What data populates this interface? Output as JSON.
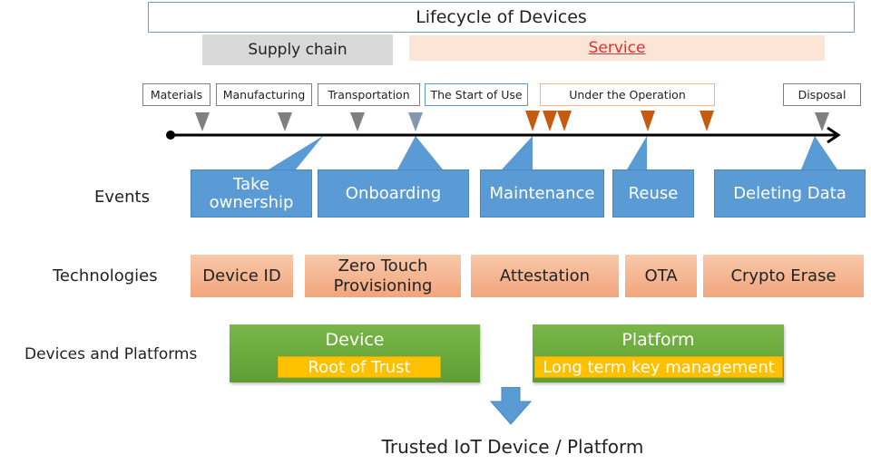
{
  "header": {
    "title": "Lifecycle of Devices",
    "supply_chain": "Supply chain",
    "service": "Service"
  },
  "stages": [
    {
      "label": "Materials",
      "style": "gray"
    },
    {
      "label": "Manufacturing",
      "style": "gray"
    },
    {
      "label": "Transportation",
      "style": "gray"
    },
    {
      "label": "The Start of Use",
      "style": "blue"
    },
    {
      "label": "Under the Operation",
      "style": "orange"
    },
    {
      "label": "Disposal",
      "style": "gray"
    }
  ],
  "markers": {
    "colors": {
      "gray": "#7f7f7f",
      "blue_gray": "#8497b0",
      "orange": "#c55a11"
    },
    "count_gray": 4,
    "count_orange": 5,
    "count_disposal": 1
  },
  "row_labels": {
    "events": "Events",
    "technologies": "Technologies",
    "devices_platforms": "Devices and Platforms"
  },
  "events": [
    {
      "label": "Take ownership"
    },
    {
      "label": "Onboarding"
    },
    {
      "label": "Maintenance"
    },
    {
      "label": "Reuse"
    },
    {
      "label": "Deleting Data"
    }
  ],
  "technologies": [
    {
      "label": "Device ID"
    },
    {
      "label": "Zero Touch Provisioning"
    },
    {
      "label": "Attestation"
    },
    {
      "label": "OTA"
    },
    {
      "label": "Crypto Erase"
    }
  ],
  "platforms": {
    "device": {
      "title": "Device",
      "inner": "Root of Trust"
    },
    "platform": {
      "title": "Platform",
      "inner": "Long term key management"
    }
  },
  "colors": {
    "event_blue": "#5b9bd5",
    "tech_salmon": "#f4b183",
    "green": "#70ad47",
    "gold": "#ffc000",
    "service_red": "#e03030"
  },
  "footer": {
    "result": "Trusted IoT Device / Platform"
  }
}
